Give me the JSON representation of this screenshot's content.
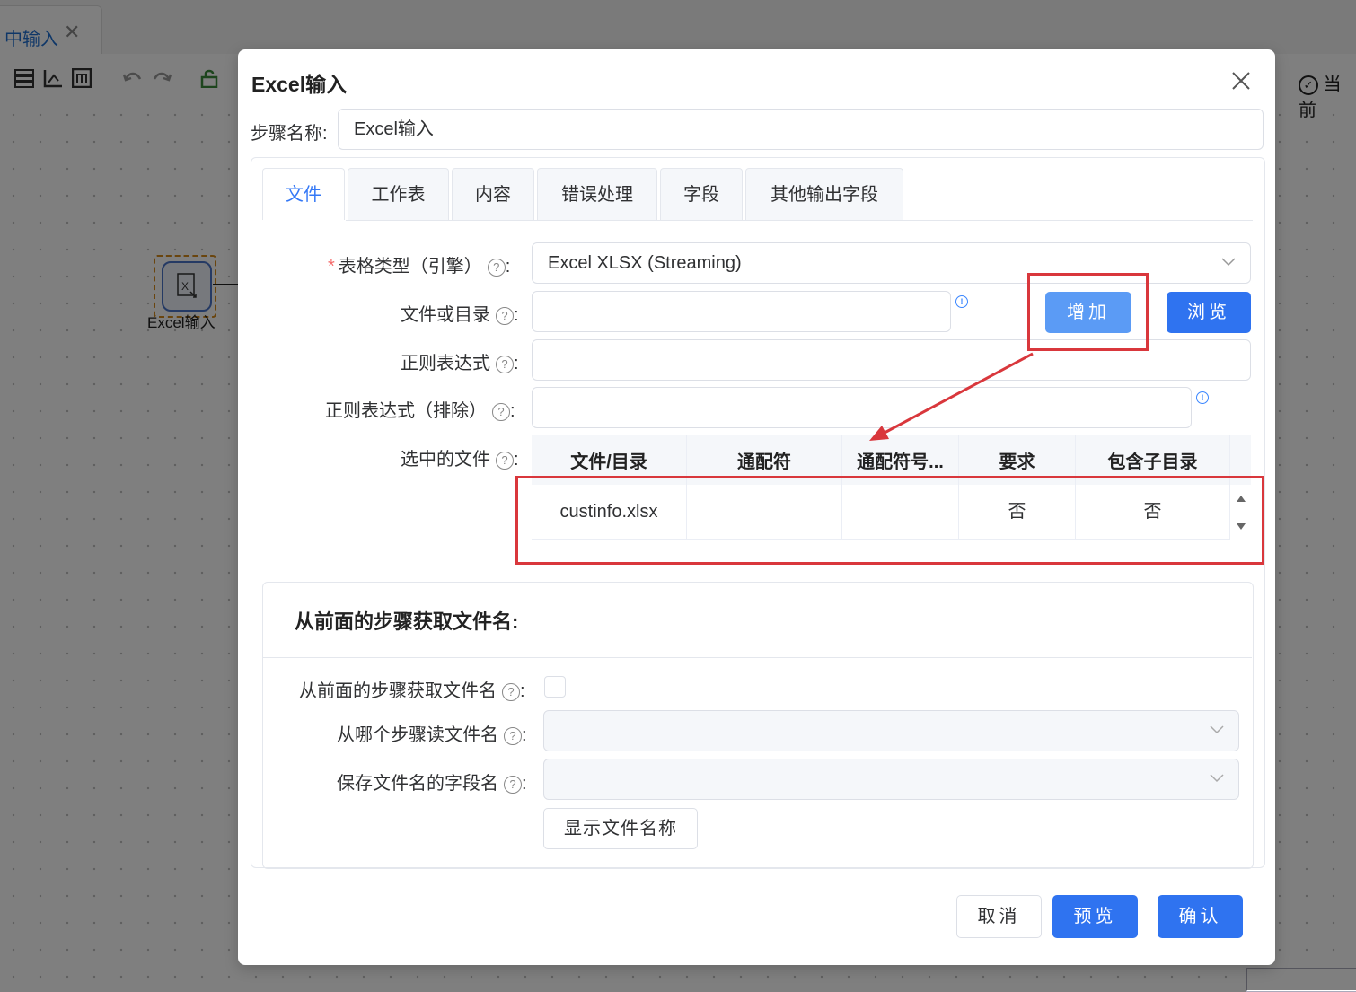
{
  "background": {
    "tab_label": "中输入",
    "tab_close": "✕",
    "node_label": "Excel输入",
    "right_label": "当前"
  },
  "dialog": {
    "title": "Excel输入",
    "step_name_label": "步骤名称:",
    "step_name_value": "Excel输入",
    "tabs": [
      "文件",
      "工作表",
      "内容",
      "错误处理",
      "字段",
      "其他输出字段"
    ],
    "active_tab": "文件",
    "form": {
      "type_label": "表格类型（引擎）",
      "type_value": "Excel XLSX (Streaming)",
      "file_label": "文件或目录",
      "regex_label": "正则表达式",
      "regex_exclude_label": "正则表达式（排除）",
      "selected_files_label": "选中的文件",
      "add_button": "增加",
      "browse_button": "浏览"
    },
    "table": {
      "headers": [
        "文件/目录",
        "通配符",
        "通配符号...",
        "要求",
        "包含子目录"
      ],
      "rows": [
        [
          "custinfo.xlsx",
          "",
          "",
          "否",
          "否"
        ]
      ]
    },
    "prev_step": {
      "title": "从前面的步骤获取文件名:",
      "accept_label": "从前面的步骤获取文件名",
      "step_label": "从哪个步骤读文件名",
      "field_label": "保存文件名的字段名",
      "show_button": "显示文件名称"
    },
    "footer": {
      "cancel": "取消",
      "preview": "预览",
      "confirm": "确认"
    }
  },
  "colors": {
    "primary": "#2f73f0",
    "annotation_red": "#d9373c"
  }
}
